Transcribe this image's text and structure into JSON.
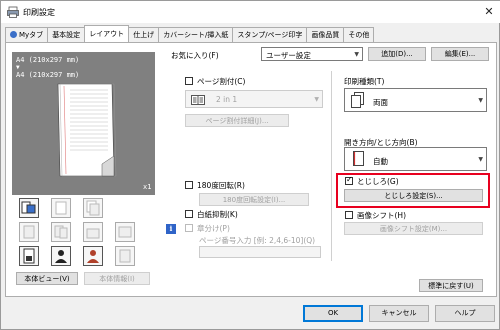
{
  "window": {
    "title": "印刷設定",
    "close_glyph": "✕"
  },
  "tabs": [
    {
      "label": "Myタブ"
    },
    {
      "label": "基本設定"
    },
    {
      "label": "レイアウト"
    },
    {
      "label": "仕上げ"
    },
    {
      "label": "カバーシート/挿入紙"
    },
    {
      "label": "スタンプ/ページ印字"
    },
    {
      "label": "画像品質"
    },
    {
      "label": "その他"
    }
  ],
  "favorites": {
    "label": "お気に入り(F)",
    "value": "ユーザー設定",
    "add_button": "追加(D)...",
    "edit_button": "編集(E)..."
  },
  "preview": {
    "line1": "A4 (210x297 mm)",
    "arrow": "▼",
    "line2": "A4 (210x297 mm)",
    "copies": "x1",
    "view_button": "本体ビュー(V)",
    "info_button": "本体情報(I)"
  },
  "layout": {
    "nup_label": "ページ割付(C)",
    "nup_value": "2 in 1",
    "nup_detail_button": "ページ割付詳細(J)...",
    "rotate_label": "180度回転(R)",
    "rotate_detail_button": "180度回転設定(I)...",
    "blank_suppress_label": "白紙抑制(K)",
    "chapter_label": "章分け(P)",
    "page_input_label": "ページ番号入力 [例: 2,4,6-10](Q)",
    "page_input_value": ""
  },
  "right": {
    "print_type_label": "印刷種類(T)",
    "print_type_value": "両面",
    "binding_label": "開き方向/とじ方向(B)",
    "binding_value": "自動",
    "margin_label": "とじしろ(G)",
    "margin_checked": true,
    "margin_button": "とじしろ設定(S)...",
    "image_shift_label": "画像シフト(H)",
    "image_shift_button": "画像シフト設定(M)...",
    "restore_button": "標準に戻す(U)"
  },
  "footer": {
    "ok": "OK",
    "cancel": "キャンセル",
    "help": "ヘルプ"
  },
  "colors": {
    "accent": "#0078d7",
    "highlight": "#e8001f",
    "preview_bg": "#808080"
  }
}
